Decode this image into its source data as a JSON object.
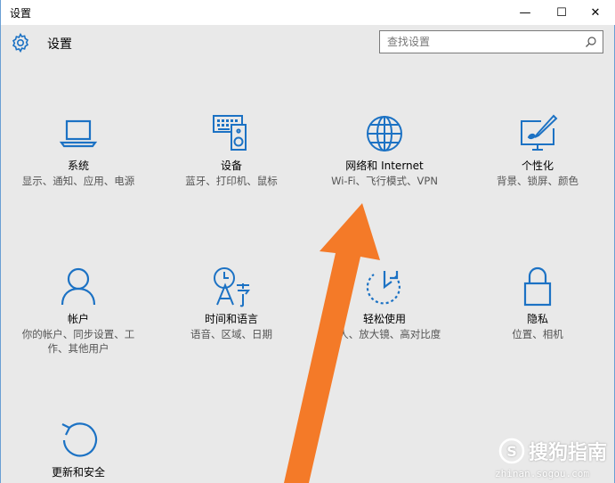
{
  "window": {
    "title": "设置",
    "minimize": "—",
    "maximize": "☐",
    "close": "✕"
  },
  "header": {
    "title": "设置",
    "search_placeholder": "查找设置"
  },
  "tiles": [
    {
      "name": "系统",
      "desc": "显示、通知、应用、电源"
    },
    {
      "name": "设备",
      "desc": "蓝牙、打印机、鼠标"
    },
    {
      "name": "网络和 Internet",
      "desc": "Wi-Fi、飞行模式、VPN"
    },
    {
      "name": "个性化",
      "desc": "背景、锁屏、颜色"
    },
    {
      "name": "帐户",
      "desc": "你的帐户、同步设置、工作、其他用户"
    },
    {
      "name": "时间和语言",
      "desc": "语音、区域、日期"
    },
    {
      "name": "轻松使用",
      "desc": "述人、放大镜、高对比度"
    },
    {
      "name": "隐私",
      "desc": "位置、相机"
    },
    {
      "name": "更新和安全",
      "desc": ""
    }
  ],
  "colors": {
    "accent": "#1c72c4",
    "arrow": "#f47a28"
  },
  "watermark": {
    "text": "搜狗指南",
    "url": "zhinan.sogou.com"
  }
}
